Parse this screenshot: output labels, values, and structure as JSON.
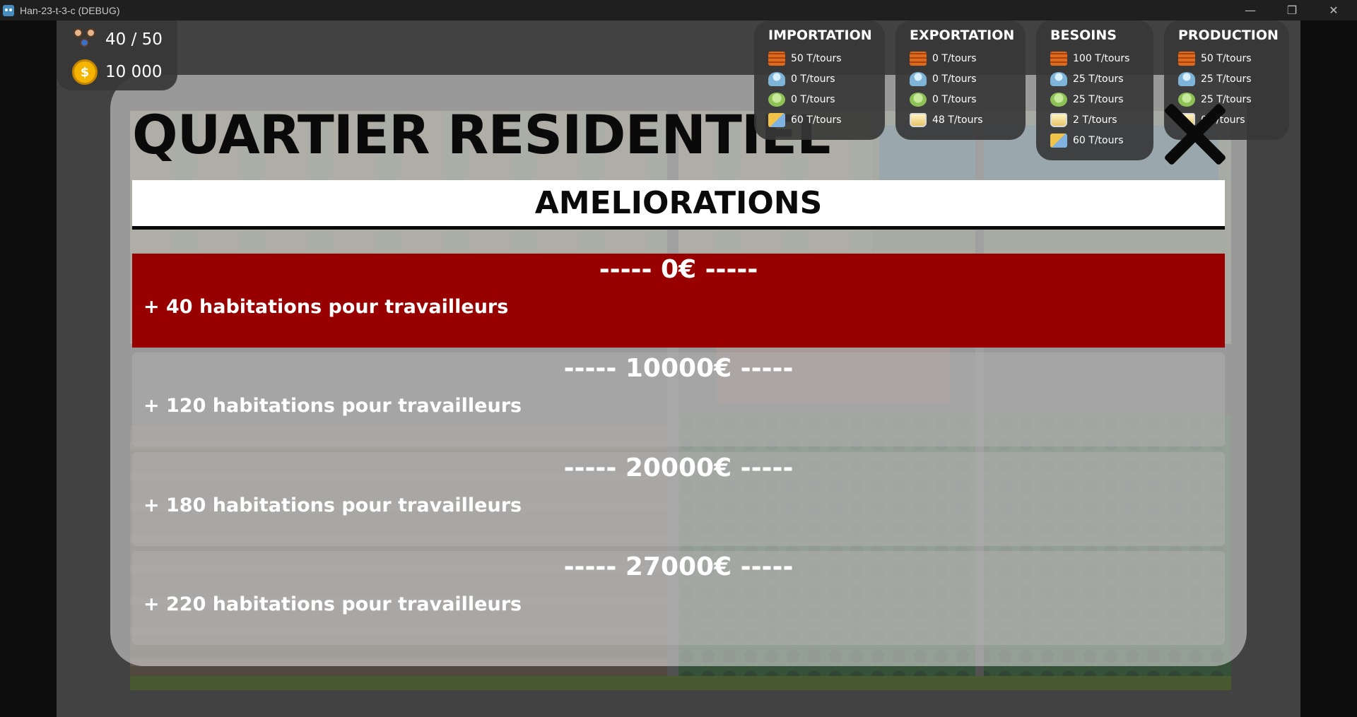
{
  "window": {
    "title": "Han-23-t-3-c (DEBUG)",
    "minimize_icon": "—",
    "maximize_icon": "❐",
    "close_icon": "✕"
  },
  "resources": {
    "population": "40 / 50",
    "money": "10 000",
    "coin_symbol": "$"
  },
  "stats": {
    "importation": {
      "title": "IMPORTATION",
      "rows": [
        {
          "icon": "wood-icon",
          "value": "50 T/tours"
        },
        {
          "icon": "water-icon",
          "value": "0 T/tours"
        },
        {
          "icon": "food-icon",
          "value": "0 T/tours"
        },
        {
          "icon": "goods-icon",
          "value": "60 T/tours"
        }
      ]
    },
    "exportation": {
      "title": "EXPORTATION",
      "rows": [
        {
          "icon": "wood-icon",
          "value": "0 T/tours"
        },
        {
          "icon": "water-icon",
          "value": "0 T/tours"
        },
        {
          "icon": "food-icon",
          "value": "0 T/tours"
        },
        {
          "icon": "drink-icon",
          "value": "48 T/tours"
        }
      ]
    },
    "besoins": {
      "title": "BESOINS",
      "rows": [
        {
          "icon": "wood-icon",
          "value": "100 T/tours"
        },
        {
          "icon": "water-icon",
          "value": "25 T/tours"
        },
        {
          "icon": "food-icon",
          "value": "25 T/tours"
        },
        {
          "icon": "drink-icon",
          "value": "2 T/tours"
        },
        {
          "icon": "goods-icon",
          "value": "60 T/tours"
        }
      ]
    },
    "production": {
      "title": "PRODUCTION",
      "rows": [
        {
          "icon": "wood-icon",
          "value": "50 T/tours"
        },
        {
          "icon": "water-icon",
          "value": "25 T/tours"
        },
        {
          "icon": "food-icon",
          "value": "25 T/tours"
        },
        {
          "icon": "drink-icon",
          "value": "0 T/tours"
        }
      ]
    }
  },
  "modal": {
    "title": "QUARTIER RESIDENTIEL",
    "section_title": "AMELIORATIONS",
    "upgrades": [
      {
        "price": "----- 0€ -----",
        "description": "+ 40 habitations pour travailleurs",
        "state": "active"
      },
      {
        "price": "----- 10000€ -----",
        "description": "+ 120 habitations pour travailleurs",
        "state": "locked"
      },
      {
        "price": "----- 20000€ -----",
        "description": "+ 180 habitations pour travailleurs",
        "state": "locked"
      },
      {
        "price": "----- 27000€ -----",
        "description": "+ 220 habitations pour travailleurs",
        "state": "locked"
      }
    ]
  },
  "colors": {
    "active_upgrade": "#980000",
    "panel_background": "#373737"
  }
}
